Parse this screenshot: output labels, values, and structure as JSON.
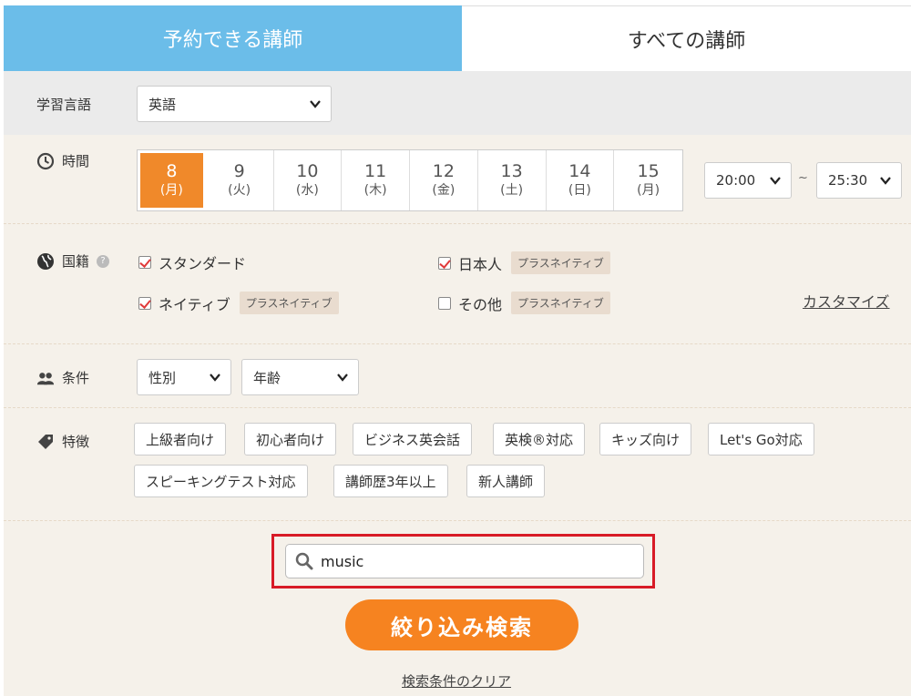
{
  "tabs": {
    "active": "予約できる講師",
    "inactive": "すべての講師"
  },
  "language": {
    "label": "学習言語",
    "value": "英語"
  },
  "time": {
    "label": "時間",
    "dates": [
      {
        "day": "8",
        "weekday": "(月)"
      },
      {
        "day": "9",
        "weekday": "(火)"
      },
      {
        "day": "10",
        "weekday": "(水)"
      },
      {
        "day": "11",
        "weekday": "(木)"
      },
      {
        "day": "12",
        "weekday": "(金)"
      },
      {
        "day": "13",
        "weekday": "(土)"
      },
      {
        "day": "14",
        "weekday": "(日)"
      },
      {
        "day": "15",
        "weekday": "(月)"
      }
    ],
    "from": "20:00",
    "sep": "~",
    "to": "25:30"
  },
  "nationality": {
    "label": "国籍",
    "standard": "スタンダード",
    "japanese": "日本人",
    "native": "ネイティブ",
    "other": "その他",
    "plus_native": "プラスネイティブ",
    "customize": "カスタマイズ"
  },
  "conditions": {
    "label": "条件",
    "gender": "性別",
    "age": "年齢"
  },
  "features": {
    "label": "特徴",
    "tags": [
      "上級者向け",
      "初心者向け",
      "ビジネス英会話",
      "英検®対応",
      "キッズ向け",
      "Let's Go対応",
      "スピーキングテスト対応",
      "講師歴3年以上",
      "新人講師"
    ]
  },
  "search": {
    "value": "music",
    "button": "絞り込み検索",
    "clear": "検索条件のクリア"
  },
  "colors": {
    "tab_active": "#6bbde9",
    "selected_date": "#f0892a",
    "search_button": "#f68320",
    "highlight": "#d81b27"
  }
}
